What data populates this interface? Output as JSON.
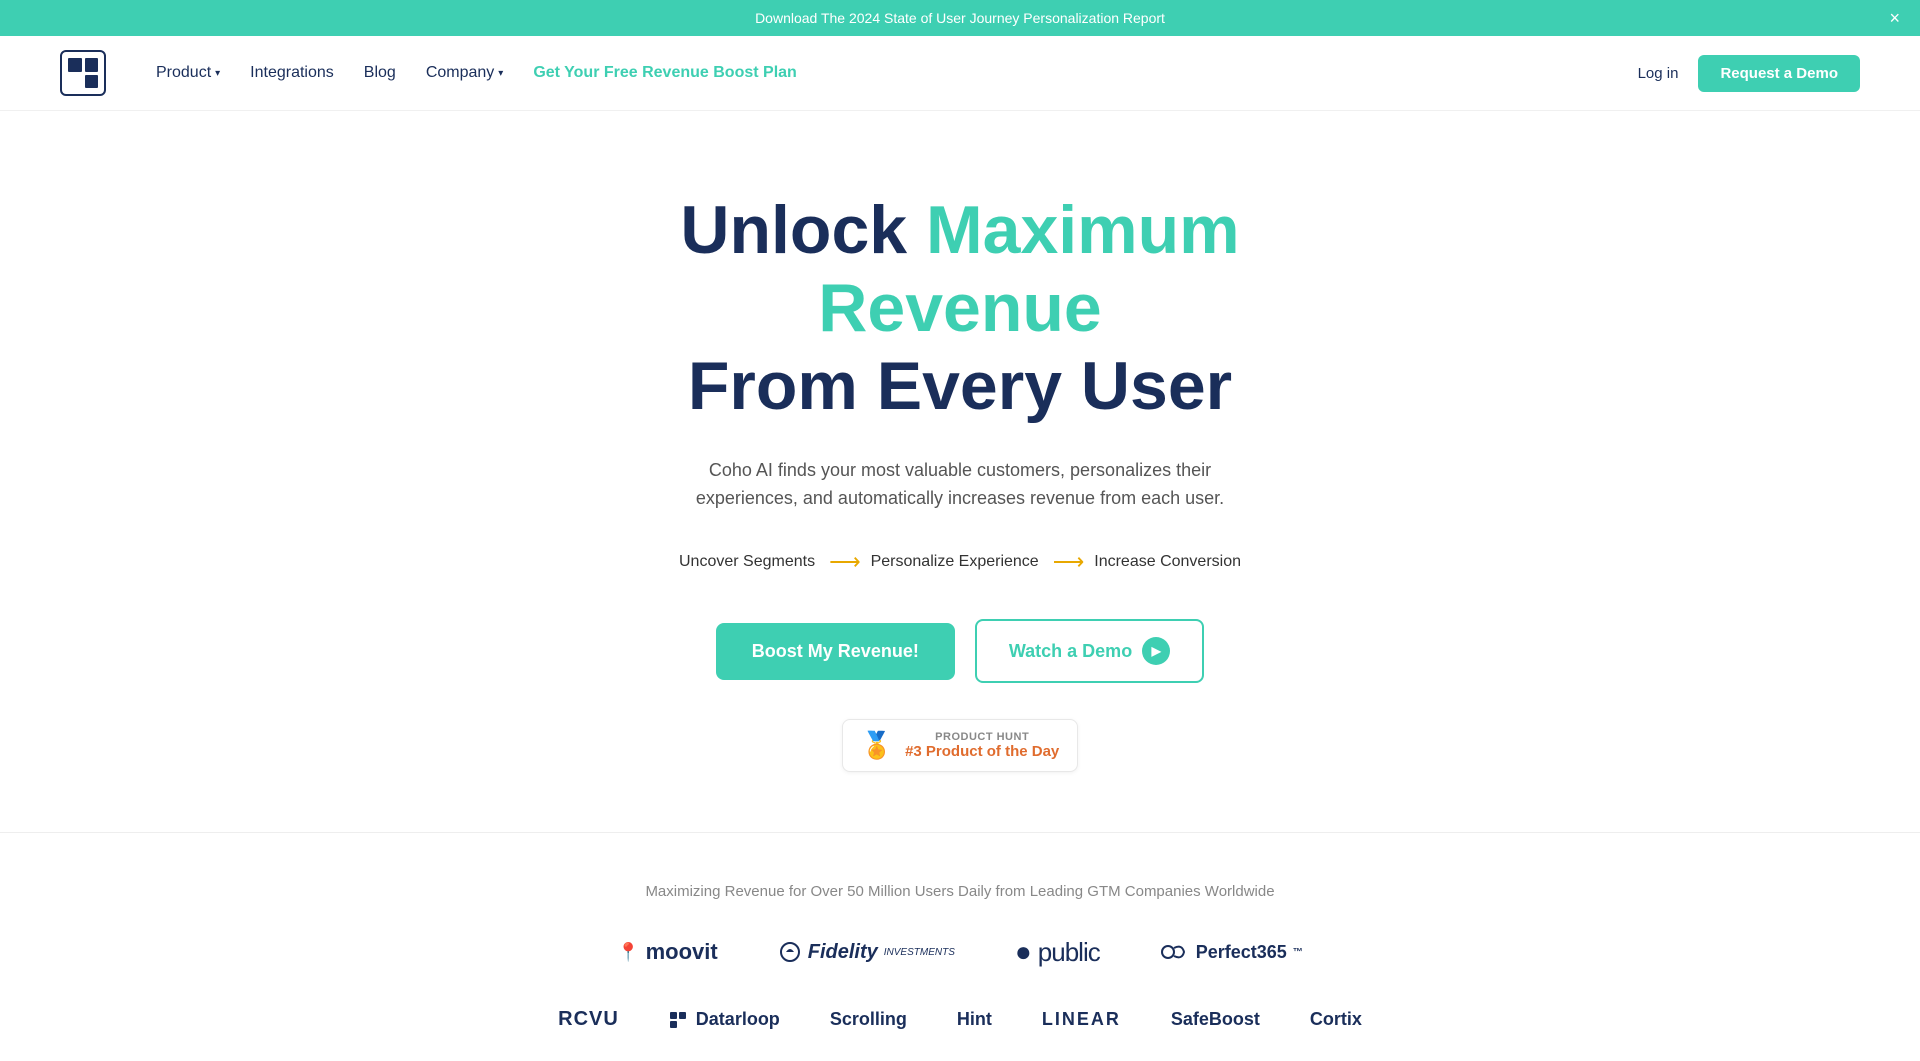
{
  "banner": {
    "text": "Download The 2024 State of User Journey Personalization Report",
    "close_label": "×"
  },
  "navbar": {
    "logo_alt": "Coho AI Logo",
    "product_label": "Product",
    "integrations_label": "Integrations",
    "blog_label": "Blog",
    "company_label": "Company",
    "cta_label": "Get Your Free Revenue Boost Plan",
    "login_label": "Log in",
    "demo_label": "Request a Demo"
  },
  "hero": {
    "title_part1": "Unlock ",
    "title_highlight": "Maximum Revenue",
    "title_part2": "From Every User",
    "subtitle": "Coho AI finds your most valuable customers, personalizes their experiences, and automatically increases revenue from each user.",
    "flow_step1": "Uncover Segments",
    "flow_step2": "Personalize Experience",
    "flow_step3": "Increase Conversion",
    "boost_btn": "Boost My Revenue!",
    "demo_btn": "Watch a Demo",
    "ph_label": "PRODUCT HUNT",
    "ph_badge": "#3 Product of the Day"
  },
  "social": {
    "label": "Maximizing Revenue for Over 50 Million Users Daily from Leading GTM Companies Worldwide",
    "companies_row1": [
      {
        "name": "moovit",
        "display": "moovit"
      },
      {
        "name": "fidelity",
        "display": "Fidelity"
      },
      {
        "name": "public",
        "display": "public"
      },
      {
        "name": "perfect365",
        "display": "Perfect365"
      }
    ],
    "companies_row2": [
      {
        "name": "rcvu",
        "display": "RCVU"
      },
      {
        "name": "datarloop",
        "display": "Datarloop"
      },
      {
        "name": "scrolling1",
        "display": "Scrolling"
      },
      {
        "name": "hint",
        "display": "Hint"
      },
      {
        "name": "linear",
        "display": "LINEAR"
      },
      {
        "name": "safeboost",
        "display": "SafeBoost"
      },
      {
        "name": "cortix",
        "display": "Cortix"
      }
    ]
  }
}
